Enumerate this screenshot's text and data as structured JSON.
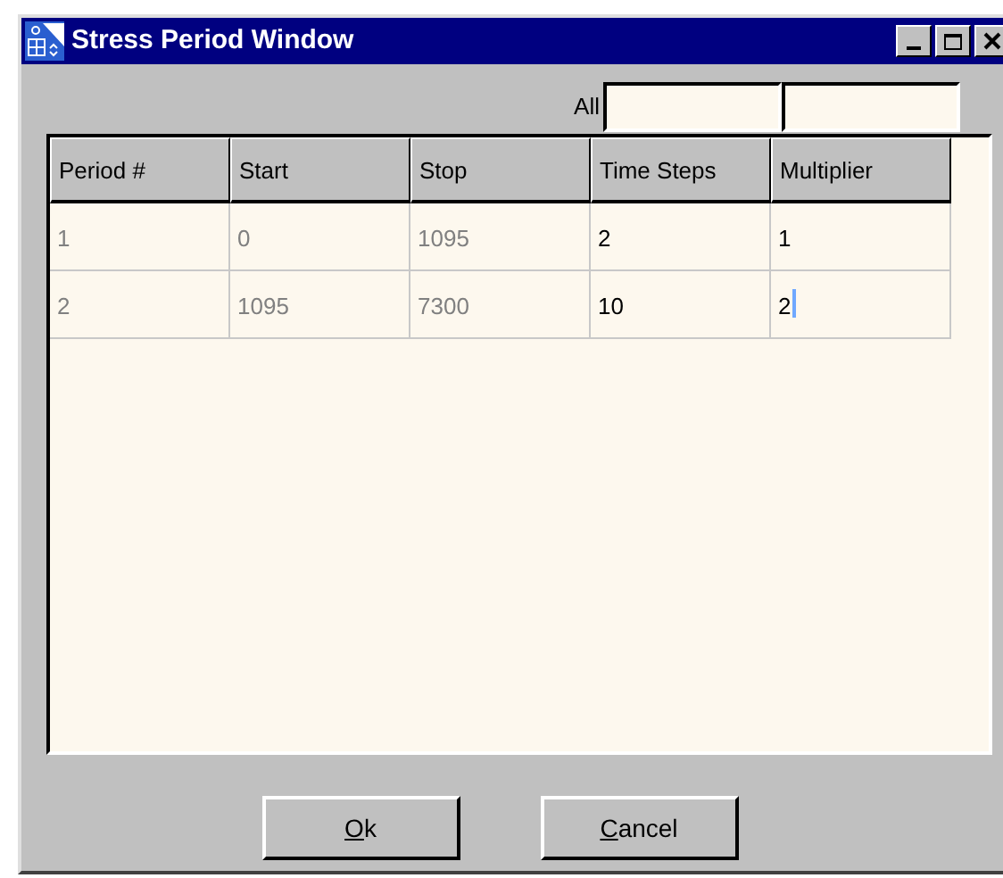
{
  "window": {
    "title": "Stress Period Window"
  },
  "all_row": {
    "label": "All",
    "fields": [
      {
        "kind": "input"
      },
      {
        "kind": "input"
      }
    ]
  },
  "table": {
    "columns": [
      {
        "label": "Period #",
        "editable": false
      },
      {
        "label": "Start",
        "editable": false
      },
      {
        "label": "Stop",
        "editable": false
      },
      {
        "label": "Time Steps",
        "editable": true
      },
      {
        "label": "Multiplier",
        "editable": true
      }
    ],
    "rows": [
      [
        {
          "text": "1",
          "focused": false
        },
        {
          "text": "0",
          "focused": false
        },
        {
          "text": "1095",
          "focused": false
        },
        {
          "text": "2",
          "focused": false
        },
        {
          "text": "1",
          "focused": false
        }
      ],
      [
        {
          "text": "2",
          "focused": false
        },
        {
          "text": "1095",
          "focused": false
        },
        {
          "text": "7300",
          "focused": false
        },
        {
          "text": "10",
          "focused": false
        },
        {
          "text": "2",
          "focused": true
        }
      ]
    ]
  },
  "buttons": [
    {
      "label": "Ok",
      "underline_first": true
    },
    {
      "label": "Cancel",
      "underline_first": true
    }
  ]
}
